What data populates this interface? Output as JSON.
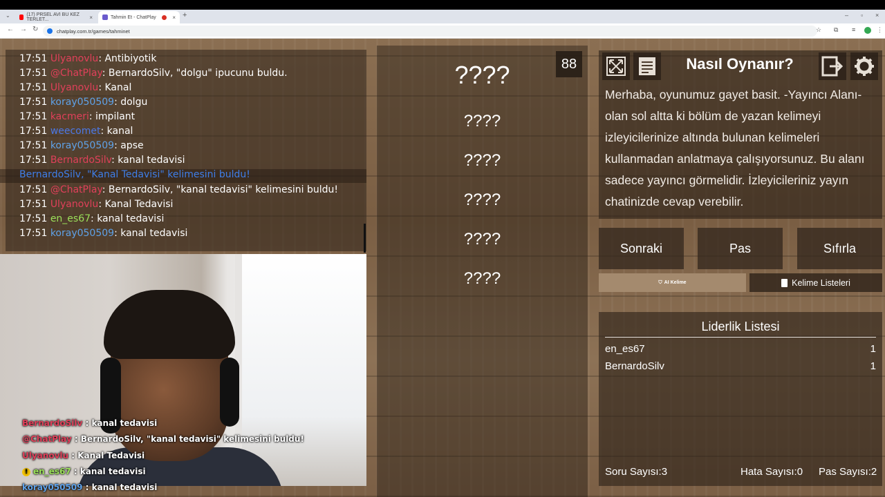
{
  "browser": {
    "tabs": [
      {
        "title": "(17) PRSEL AVI BU KEZ TERLET..."
      },
      {
        "title": "Tahmin Et - ChatPlay"
      }
    ],
    "url": "chatplay.com.tr/games/tahminet"
  },
  "chat": {
    "lines": [
      {
        "time": "17:51",
        "user": "Ulyanovlu",
        "user_color": "#e0405a",
        "message": ": Antibiyotik"
      },
      {
        "time": "17:51",
        "user": "@ChatPlay",
        "user_color": "#e0405a",
        "message": ": BernardoSilv, \"dolgu\" ipucunu buldu."
      },
      {
        "time": "17:51",
        "user": "Ulyanovlu",
        "user_color": "#e0405a",
        "message": ": Kanal"
      },
      {
        "time": "17:51",
        "user": "koray050509",
        "user_color": "#5fa2e8",
        "message": ": dolgu"
      },
      {
        "time": "17:51",
        "user": "kacmeri",
        "user_color": "#e0405a",
        "message": ": impilant"
      },
      {
        "time": "17:51",
        "user": "weecomet",
        "user_color": "#4b78e6",
        "message": ": kanal"
      },
      {
        "time": "17:51",
        "user": "koray050509",
        "user_color": "#5fa2e8",
        "message": ": apse"
      },
      {
        "time": "17:51",
        "user": "BernardoSilv",
        "user_color": "#e0405a",
        "message": ": kanal tedavisi"
      },
      {
        "time": "17:51",
        "user": "@ChatPlay",
        "user_color": "#e0405a",
        "message": ": BernardoSilv, \"kanal tedavisi\" kelimesini buldu!"
      },
      {
        "time": "17:51",
        "user": "Ulyanovlu",
        "user_color": "#e0405a",
        "message": ": Kanal Tedavisi"
      },
      {
        "time": "17:51",
        "user": "en_es67",
        "user_color": "#9be05a",
        "message": ": kanal tedavisi"
      },
      {
        "time": "17:51",
        "user": "koray050509",
        "user_color": "#5fa2e8",
        "message": ": kanal tedavisi"
      }
    ],
    "system": {
      "name": "BernardoSilv",
      "rest": ", \"Kanal Tedavisi\" kelimesini buldu!",
      "name_color": "#3f7ee8",
      "rest_color": "#3f7ee8",
      "word_color": "#4caf50"
    }
  },
  "overlay": [
    {
      "user": "BernardoSilv",
      "color": "#e0405a",
      "message": " : kanal tedavisi"
    },
    {
      "user": "@ChatPlay",
      "color": "#e0405a",
      "message": " : BernardoSilv, \"kanal tedavisi\" kelimesini buldu!"
    },
    {
      "user": "Ulyanovlu",
      "color": "#e0405a",
      "message": " : Kanal Tedavisi"
    },
    {
      "user": "en_es67",
      "color": "#9be05a",
      "message": " : kanal tedavisi"
    },
    {
      "user": "koray050509",
      "color": "#5fa2e8",
      "message": " : kanal tedavisi"
    }
  ],
  "game": {
    "counter": "88",
    "words": [
      "????",
      "????",
      "????",
      "????",
      "????",
      "????"
    ]
  },
  "how_to": {
    "title": "Nasıl Oynanır?",
    "text": "Merhaba, oyunumuz gayet basit. -Yayıncı Alanı- olan sol altta ki bölüm de yazan kelimeyi izleyicilerinize altında bulunan kelimeleri kullanmadan anlatmaya çalışıyorsunuz. Bu alanı sadece yayıncı görmelidir. İzleyicileriniz yayın chatinizde cevap verebilir."
  },
  "buttons": {
    "next": "Sonraki",
    "pass": "Pas",
    "reset": "Sıfırla",
    "ai_word": "AI Kelime",
    "word_lists": "Kelime Listeleri"
  },
  "leaderboard": {
    "title": "Liderlik Listesi",
    "rows": [
      {
        "name": "en_es67",
        "score": "1"
      },
      {
        "name": "BernardoSilv",
        "score": "1"
      }
    ]
  },
  "stats": {
    "questions": "Soru Sayısı:3",
    "errors": "Hata Sayısı:0",
    "passes": "Pas Sayısı:2"
  },
  "icons": [
    "fullscreen-icon",
    "document-icon",
    "exit-icon",
    "gear-icon",
    "shield-icon",
    "clipboard-icon",
    "warning-icon"
  ]
}
